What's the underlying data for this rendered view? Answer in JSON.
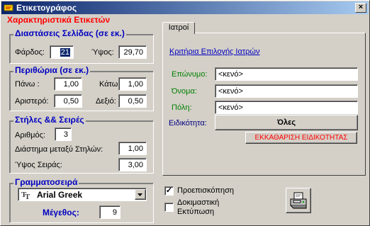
{
  "window": {
    "title": "Ετικετογράφος",
    "close_glyph": "×"
  },
  "section_heading": "Χαρακτηριστικά Ετικετών",
  "page_size": {
    "title": "Διαστάσεις Σελίδας (σε εκ.)",
    "width_label": "Φάρδος:",
    "width_value": "21",
    "height_label": "Ύψος:",
    "height_value": "29,70"
  },
  "margins": {
    "title": "Περιθώρια (σε εκ.)",
    "top_label": "Πάνω :",
    "top_value": "1,00",
    "bottom_label": "Κάτω:",
    "bottom_value": "1,00",
    "left_label": "Αριστερό:",
    "left_value": "0,50",
    "right_label": "Δεξιό:",
    "right_value": "0,50"
  },
  "columns_rows": {
    "title": "Στήλες && Σειρές",
    "count_label": "Αριθμός:",
    "count_value": "3",
    "spacing_label": "Διάστημα μεταξύ Στηλών:",
    "spacing_value": "1,00",
    "row_height_label": "Ύψος Σειράς:",
    "row_height_value": "3,00"
  },
  "font": {
    "title": "Γραμματοσειρά",
    "family": "Arial Greek",
    "size_label": "Μέγεθος:",
    "size_value": "9"
  },
  "tab": {
    "label": "Ιατροί",
    "criteria_title": "Κριτήρια Επιλογής Ιατρών",
    "surname_label": "Επώνυμο:",
    "surname_value": "<κενό>",
    "name_label": "Όνομα:",
    "name_value": "<κενό>",
    "city_label": "Πόλη:",
    "city_value": "<κενό>",
    "specialty_label": "Ειδικότητα:",
    "specialty_button": "Όλες",
    "clear_specialty_button": "ΕΚΚΑΘΑΡΙΣΗ ΕΙΔΙΚΟΤΗΤΑΣ"
  },
  "options": {
    "preview_label": "Προεπισκόπηση",
    "preview_checked": true,
    "test_print_label": "Δοκιμαστική Εκτύπωση",
    "test_print_checked": false
  },
  "icons": {
    "app": "label-writer-icon",
    "font_type": "truetype-icon",
    "print": "printer-icon",
    "dropdown": "dropdown-arrow-icon"
  },
  "colors": {
    "group_title": "#0000c0",
    "section_heading": "#ff0000",
    "field_label": "#008000",
    "link": "#0000c0",
    "clear_button_text": "#ff0000",
    "selection": "#0a246a"
  }
}
